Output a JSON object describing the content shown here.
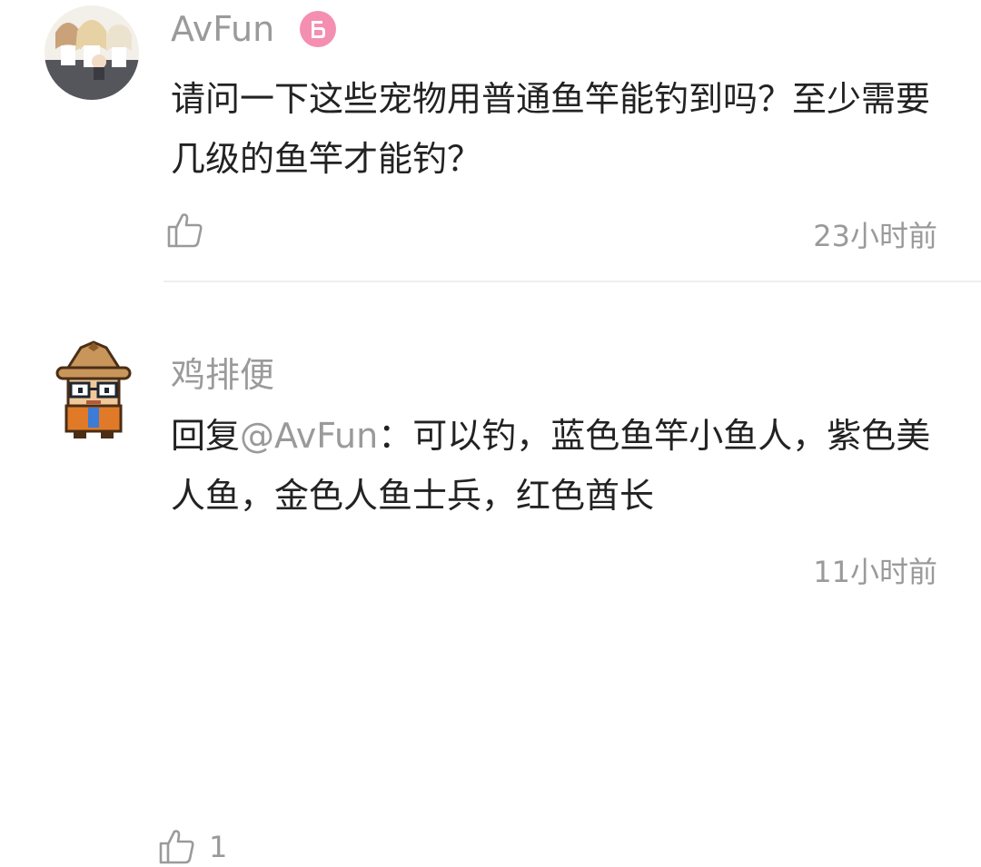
{
  "comments": [
    {
      "username": "AvFun",
      "badge_icon": "level-badge-icon",
      "text": "请问一下这些宠物用普通鱼竿能钓到吗？至少需要几级的鱼竿才能钓？",
      "likes": "",
      "time": "23小时前"
    },
    {
      "username": "鸡排便",
      "reply_prefix": "回复",
      "reply_target": "@AvFun",
      "text": "：可以钓，蓝色鱼竿小鱼人，紫色美人鱼，金色人鱼士兵，红色酋长",
      "likes": "1",
      "time": "11小时前"
    }
  ],
  "icons": {
    "like": "thumbs-up-icon"
  },
  "colors": {
    "muted_text": "#9a9a9a",
    "body_text": "#222222",
    "badge_pink": "#f48fb1",
    "divider": "#eeeeee"
  }
}
